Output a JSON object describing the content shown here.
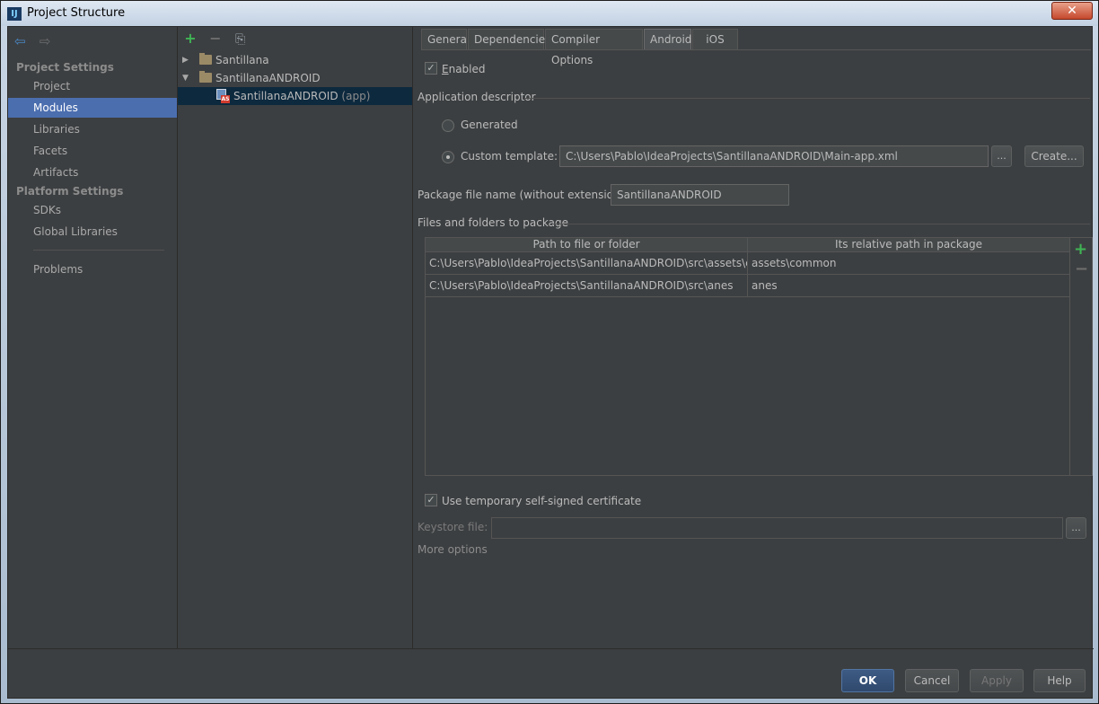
{
  "window": {
    "title": "Project Structure",
    "close_glyph": "✕",
    "app_icon_text": "IJ"
  },
  "sidebar": {
    "back_glyph": "⇦",
    "forward_glyph": "⇨",
    "project_settings_header": "Project Settings",
    "project_items": [
      "Project",
      "Modules",
      "Libraries",
      "Facets",
      "Artifacts"
    ],
    "selected": "Modules",
    "platform_settings_header": "Platform Settings",
    "platform_items": [
      "SDKs",
      "Global Libraries"
    ],
    "problems": "Problems"
  },
  "tree": {
    "toolbar": {
      "add_glyph": "+",
      "remove_glyph": "−",
      "copy_glyph": "⎘"
    },
    "nodes": [
      {
        "label": "Santillana",
        "expanded": false
      },
      {
        "label": "SantillanaANDROID",
        "expanded": true
      },
      {
        "label": "SantillanaANDROID",
        "suffix": "(app)",
        "selected": true
      }
    ],
    "collapsed_glyph": "▶",
    "expanded_glyph": "▼",
    "app_badge": "AS"
  },
  "tabs": [
    "General",
    "Dependencies",
    "Compiler Options",
    "Android",
    "iOS"
  ],
  "selected_tab": "Android",
  "android": {
    "enabled": {
      "label": "Enabled",
      "checked": true,
      "check_glyph": "✓"
    },
    "app_descriptor": {
      "title": "Application descriptor",
      "generated_label": "Generated",
      "custom_template_label": "Custom template:",
      "custom_template_selected": true,
      "template_path": "C:\\Users\\Pablo\\IdeaProjects\\SantillanaANDROID\\Main-app.xml",
      "browse_label": "...",
      "create_label": "Create..."
    },
    "package_name": {
      "label": "Package file name (without extension):",
      "value": "SantillanaANDROID"
    },
    "files": {
      "title": "Files and folders to package",
      "columns": [
        "Path to file or folder",
        "Its relative path in package"
      ],
      "rows": [
        {
          "path": "C:\\Users\\Pablo\\IdeaProjects\\SantillanaANDROID\\src\\assets\\com...",
          "relative": "assets\\common"
        },
        {
          "path": "C:\\Users\\Pablo\\IdeaProjects\\SantillanaANDROID\\src\\anes",
          "relative": "anes"
        }
      ],
      "add_glyph": "+",
      "remove_glyph": "−"
    },
    "certificate": {
      "label": "Use temporary self-signed certificate",
      "checked": true,
      "keystore_label": "Keystore file:",
      "keystore_value": "",
      "browse_label": "...",
      "more_options": "More options"
    }
  },
  "footer": {
    "ok": "OK",
    "cancel": "Cancel",
    "apply": "Apply",
    "help": "Help"
  }
}
